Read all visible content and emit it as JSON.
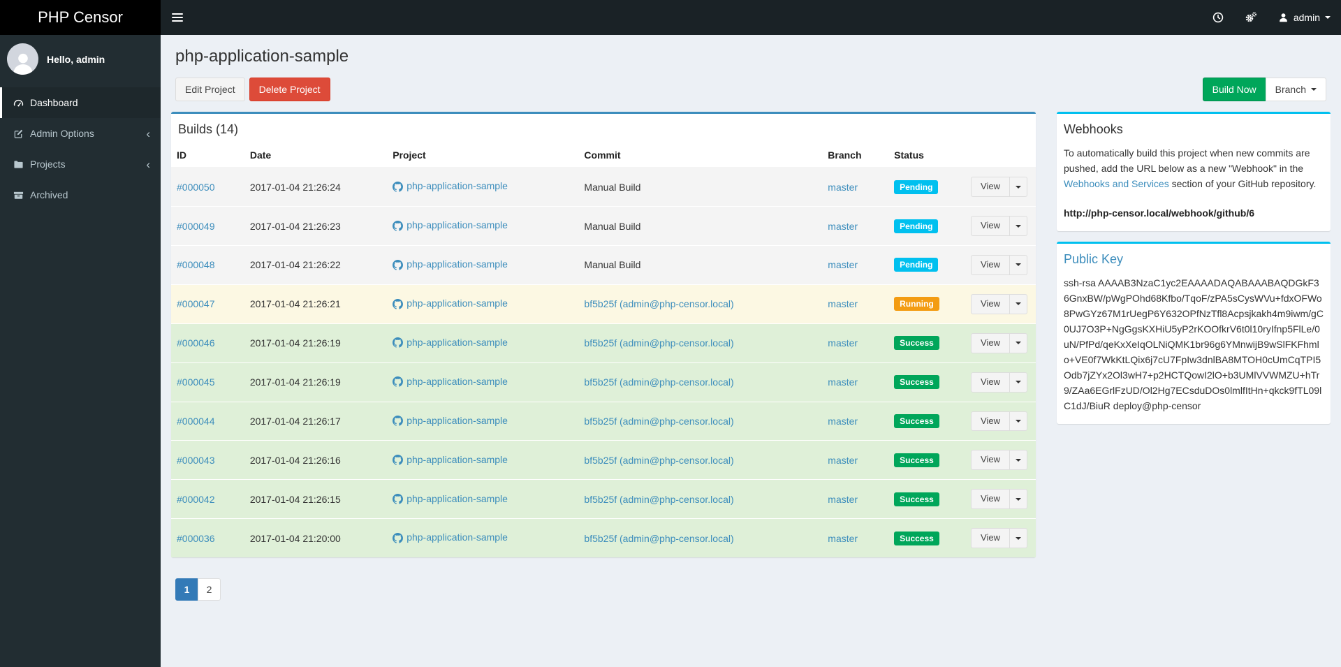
{
  "navbar": {
    "brand": "PHP Censor",
    "username": "admin"
  },
  "sidebar": {
    "greeting": "Hello, admin",
    "items": [
      {
        "label": "Dashboard",
        "icon": "dashboard-gauge",
        "active": true
      },
      {
        "label": "Admin Options",
        "icon": "edit-pencil",
        "active": false
      },
      {
        "label": "Projects",
        "icon": "folder",
        "active": false
      },
      {
        "label": "Archived",
        "icon": "archive-box",
        "active": false
      }
    ]
  },
  "page": {
    "title": "php-application-sample",
    "edit_button": "Edit Project",
    "delete_button": "Delete Project",
    "build_now_button": "Build Now",
    "branch_button": "Branch"
  },
  "builds": {
    "title": "Builds (14)",
    "columns": {
      "id": "ID",
      "date": "Date",
      "project": "Project",
      "commit": "Commit",
      "branch": "Branch",
      "status": "Status"
    },
    "view_button": "View",
    "rows": [
      {
        "id": "#000050",
        "date": "2017-01-04 21:26:24",
        "project": "php-application-sample",
        "commit": "Manual Build",
        "commit_link": false,
        "branch": "master",
        "status": "Pending"
      },
      {
        "id": "#000049",
        "date": "2017-01-04 21:26:23",
        "project": "php-application-sample",
        "commit": "Manual Build",
        "commit_link": false,
        "branch": "master",
        "status": "Pending"
      },
      {
        "id": "#000048",
        "date": "2017-01-04 21:26:22",
        "project": "php-application-sample",
        "commit": "Manual Build",
        "commit_link": false,
        "branch": "master",
        "status": "Pending"
      },
      {
        "id": "#000047",
        "date": "2017-01-04 21:26:21",
        "project": "php-application-sample",
        "commit": "bf5b25f (admin@php-censor.local)",
        "commit_link": true,
        "branch": "master",
        "status": "Running"
      },
      {
        "id": "#000046",
        "date": "2017-01-04 21:26:19",
        "project": "php-application-sample",
        "commit": "bf5b25f (admin@php-censor.local)",
        "commit_link": true,
        "branch": "master",
        "status": "Success"
      },
      {
        "id": "#000045",
        "date": "2017-01-04 21:26:19",
        "project": "php-application-sample",
        "commit": "bf5b25f (admin@php-censor.local)",
        "commit_link": true,
        "branch": "master",
        "status": "Success"
      },
      {
        "id": "#000044",
        "date": "2017-01-04 21:26:17",
        "project": "php-application-sample",
        "commit": "bf5b25f (admin@php-censor.local)",
        "commit_link": true,
        "branch": "master",
        "status": "Success"
      },
      {
        "id": "#000043",
        "date": "2017-01-04 21:26:16",
        "project": "php-application-sample",
        "commit": "bf5b25f (admin@php-censor.local)",
        "commit_link": true,
        "branch": "master",
        "status": "Success"
      },
      {
        "id": "#000042",
        "date": "2017-01-04 21:26:15",
        "project": "php-application-sample",
        "commit": "bf5b25f (admin@php-censor.local)",
        "commit_link": true,
        "branch": "master",
        "status": "Success"
      },
      {
        "id": "#000036",
        "date": "2017-01-04 21:20:00",
        "project": "php-application-sample",
        "commit": "bf5b25f (admin@php-censor.local)",
        "commit_link": true,
        "branch": "master",
        "status": "Success"
      }
    ],
    "pagination": [
      {
        "label": "1",
        "active": true
      },
      {
        "label": "2",
        "active": false
      }
    ]
  },
  "webhooks": {
    "title": "Webhooks",
    "intro_before_link": "To automatically build this project when new commits are pushed, add the URL below as a new \"Webhook\" in the ",
    "link_text": "Webhooks and Services",
    "intro_after_link": " section of your GitHub repository.",
    "url": "http://php-censor.local/webhook/github/6"
  },
  "public_key": {
    "title": "Public Key",
    "key": "ssh-rsa AAAAB3NzaC1yc2EAAAADAQABAAABAQDGkF36GnxBW/pWgPOhd68Kfbo/TqoF/zPA5sCysWVu+fdxOFWo8PwGYz67M1rUegP6Y632OPfNzTfl8Acpsjkakh4m9iwm/gC0UJ7O3P+NgGgsKXHiU5yP2rKOOfkrV6t0l10ryIfnp5FlLe/0uN/PfPd/qeKxXeIqOLNiQMK1br96g6YMnwijB9wSlFKFhmlo+VE0f7WkKtLQix6j7cU7FpIw3dnlBA8MTOH0cUmCqTPI5Odb7jZYx2Ol3wH7+p2HCTQowI2lO+b3UMlVVWMZU+hTr9/ZAa6EGrlFzUD/Ol2Hg7ECsduDOs0lmlfItHn+qkck9fTL09lC1dJ/BiuR deploy@php-censor"
  },
  "colors": {
    "primary_blue": "#3c8dbc",
    "info_cyan": "#00c0ef",
    "success_green": "#00a65a",
    "warning_orange": "#f39c12",
    "danger_red": "#dd4b39",
    "navbar_bg": "#1a2226",
    "logo_bg": "#000000",
    "sidebar_bg": "#222d32",
    "content_bg": "#ecf0f5",
    "row_pending_bg": "#f4f4f4",
    "row_running_bg": "#fcf8e3",
    "row_success_bg": "#dff0d8",
    "pagination_active_bg": "#337ab7"
  }
}
